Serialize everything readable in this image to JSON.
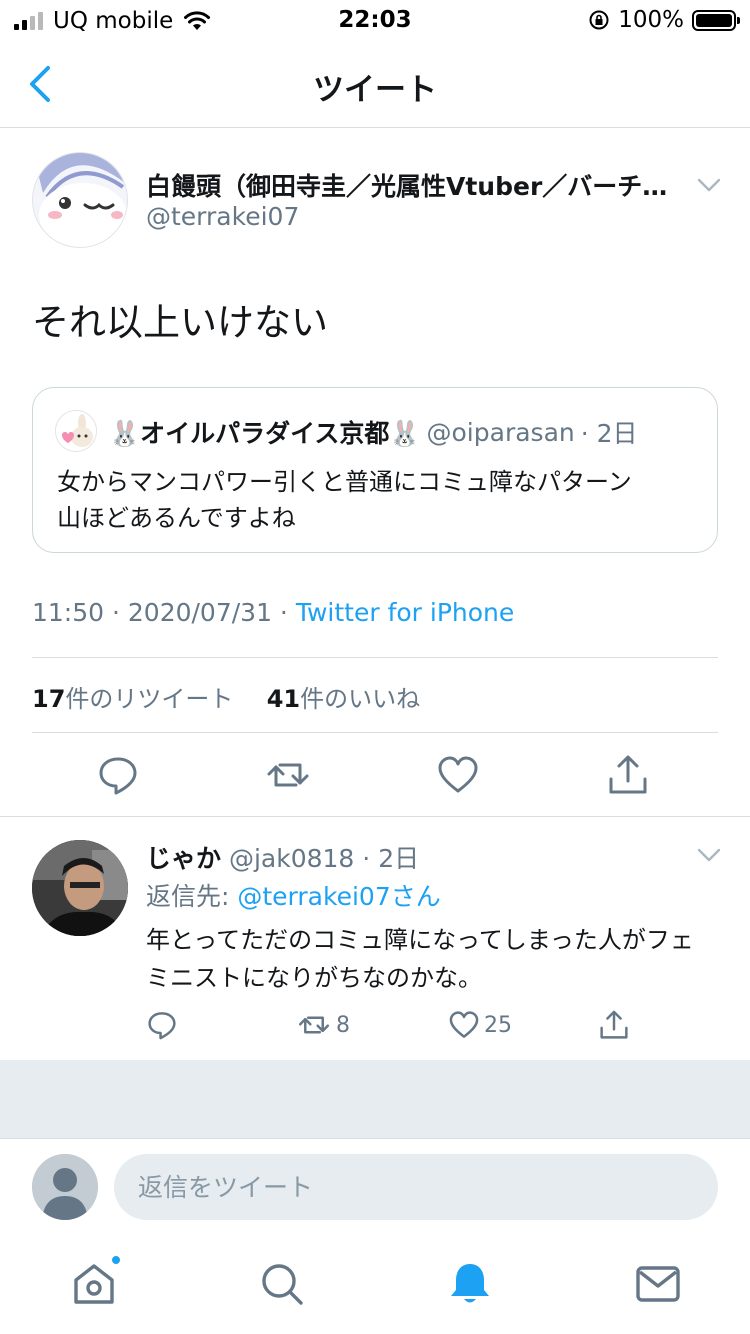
{
  "status_bar": {
    "carrier": "UQ mobile",
    "time": "22:03",
    "battery": "100%"
  },
  "nav": {
    "title": "ツイート"
  },
  "tweet": {
    "author_name": "白饅頭（御田寺圭／光属性Vtuber／バーチ…",
    "author_handle": "@terrakei07",
    "text": "それ以上いけない",
    "quote": {
      "author_name": "🐰オイルパラダイス京都🐰",
      "author_handle": "@oiparasan",
      "time": "· 2日",
      "text_line1": "女からマンコパワー引くと普通にコミュ障なパターン",
      "text_line2": "山ほどあるんですよね"
    },
    "timestamp": "11:50 · 2020/07/31 · ",
    "source": "Twitter for iPhone",
    "retweet_count": "17",
    "retweet_label": "件のリツイート",
    "like_count": "41",
    "like_label": "件のいいね"
  },
  "reply": {
    "author_name": "じゃか",
    "author_handle": "@jak0818",
    "time": "· 2日",
    "reply_to_label": "返信先: ",
    "reply_to_mention": "@terrakei07さん",
    "text": "年とってただのコミュ障になってしまった人がフェミニストになりがちなのかな。",
    "retweet_count": "8",
    "like_count": "25"
  },
  "composer": {
    "placeholder": "返信をツイート"
  },
  "colors": {
    "accent": "#1da1f2",
    "secondary_text": "#657786",
    "divider": "#d8dde1"
  }
}
